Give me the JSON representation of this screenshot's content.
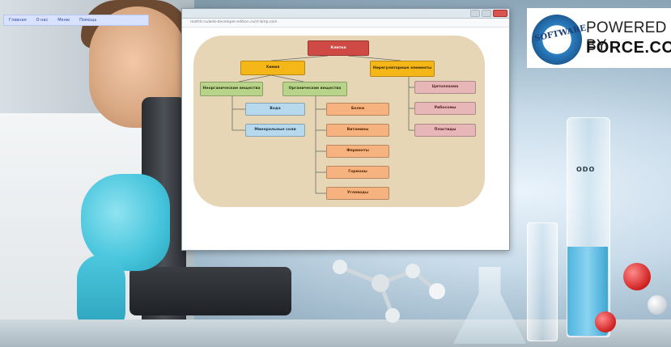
{
  "topmenu": {
    "items": [
      "Главная",
      "О нас",
      "Меню",
      "Помощь"
    ]
  },
  "powered_by": {
    "line1": "POWERED BY",
    "line2": "FORCE.COM",
    "seal": "SOFTWARE"
  },
  "browser": {
    "address": "mathtr.ru/web-developer-edition.ru/ct-bmp.com"
  },
  "diagram": {
    "root": "Клетка",
    "level1": [
      "Химия",
      "Нерегуляторные элементы"
    ],
    "level2": [
      "Неорганические вещества",
      "Органические вещества"
    ],
    "inorganic": [
      "Вода",
      "Минеральные соли"
    ],
    "organic": [
      "Белки",
      "Витамины",
      "Ферменты",
      "Гормоны",
      "Углеводы"
    ],
    "right": [
      "Цитоплазма",
      "Рибосомы",
      "Пластиды"
    ]
  },
  "colors": {
    "root": "#d04a45",
    "level1": "#f5b617",
    "level2": "#b8d48a",
    "inorganic": "#b6d9ee",
    "organic": "#f6b380",
    "right": "#e7b7b7",
    "diagram_bg": "#e6d6b5",
    "cylinder_liquid": "#4fb4df"
  },
  "background": {
    "cylinder_mark": "ODO"
  }
}
